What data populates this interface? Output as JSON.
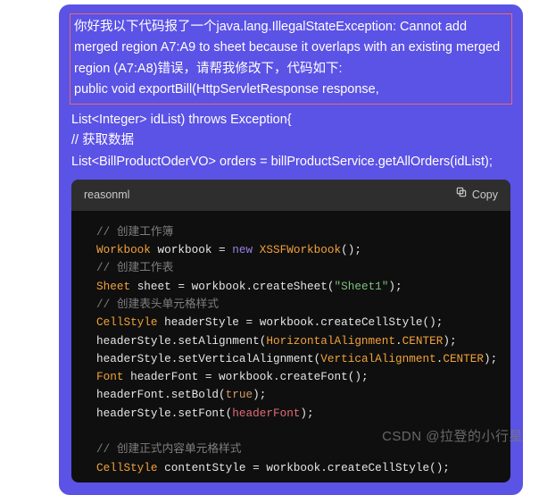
{
  "message": {
    "boxed1": "你好我以下代码报了一个java.lang.IllegalStateException: Cannot add merged region A7:A9 to sheet because it overlaps with an existing merged region (A7:A8)错误，请帮我修改下，代码如下:",
    "boxed2": "public void exportBill(HttpServletResponse response,",
    "line3": "List<Integer> idList) throws Exception{",
    "line4": "// 获取数据",
    "line5": "List<BillProductOderVO> orders = billProductService.getAllOrders(idList);"
  },
  "code": {
    "lang": "reasonml",
    "copy_label": "Copy",
    "c1": "// 创建工作簿",
    "l2_a": "Workbook",
    "l2_b": " workbook = ",
    "l2_c": "new",
    "l2_d": " ",
    "l2_e": "XSSFWorkbook",
    "l2_f": "();",
    "c3": "// 创建工作表",
    "l4_a": "Sheet",
    "l4_b": " sheet = workbook.createSheet(",
    "l4_c": "\"Sheet1\"",
    "l4_d": ");",
    "c5": "// 创建表头单元格样式",
    "l6_a": "CellStyle",
    "l6_b": " headerStyle = workbook.createCellStyle();",
    "l7_a": "headerStyle.setAlignment(",
    "l7_b": "HorizontalAlignment",
    "l7_c": ".",
    "l7_d": "CENTER",
    "l7_e": ");",
    "l8_a": "headerStyle.setVerticalAlignment(",
    "l8_b": "VerticalAlignment",
    "l8_c": ".",
    "l8_d": "CENTER",
    "l8_e": ");",
    "l9_a": "Font",
    "l9_b": " headerFont = workbook.createFont();",
    "l10_a": "headerFont.setBold(",
    "l10_b": "true",
    "l10_c": ");",
    "l11_a": "headerStyle.setFont(",
    "l11_b": "headerFont",
    "l11_c": ");",
    "c12": "// 创建正式内容单元格样式",
    "l13_a": "CellStyle",
    "l13_b": " contentStyle = workbook.createCellStyle();"
  },
  "watermark": "CSDN @拉登的小行星"
}
